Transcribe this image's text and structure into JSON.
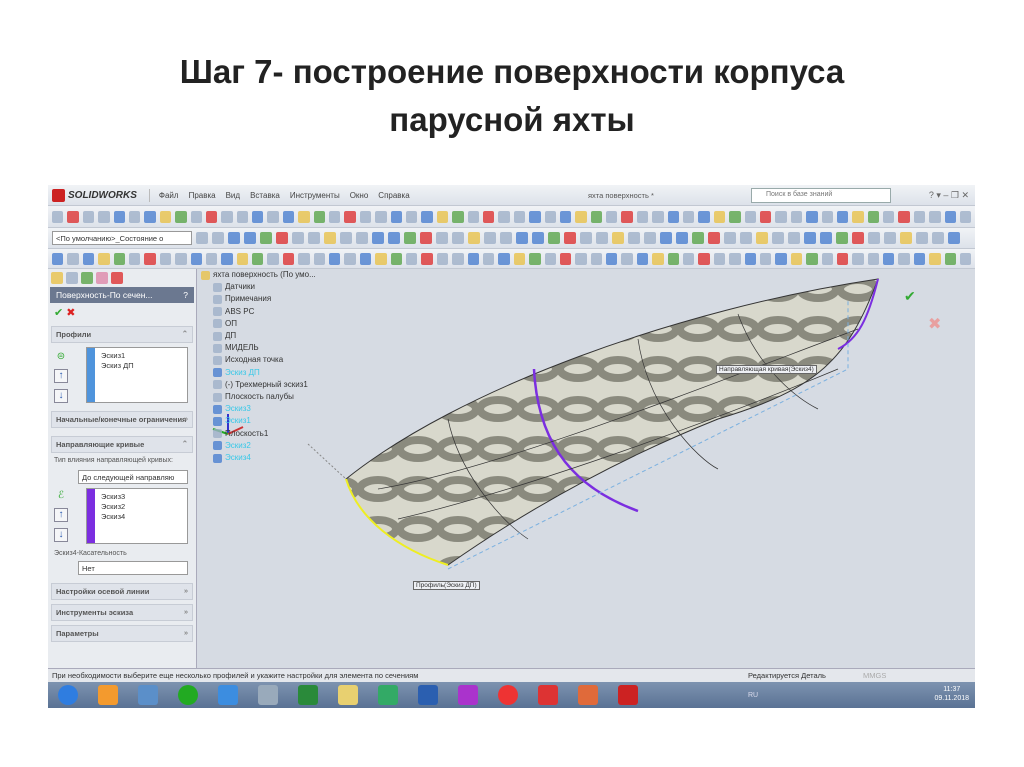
{
  "slide": {
    "title_line1": "Шаг 7- построение поверхности корпуса",
    "title_line2": "парусной яхты"
  },
  "app": {
    "brand": "SOLIDWORKS",
    "menu": [
      "Файл",
      "Правка",
      "Вид",
      "Вставка",
      "Инструменты",
      "Окно",
      "Справка"
    ],
    "doc_title": "яхта поверхность *",
    "search_placeholder": "Поиск в базе знаний",
    "config": "<По умолчанию>_Состояние о"
  },
  "panel": {
    "title": "Поверхность-По сечен...",
    "help": "?",
    "profiles_label": "Профили",
    "profiles": [
      "Эскиз1",
      "Эскиз ДП"
    ],
    "start_end": "Начальные/конечные ограничения",
    "guides_label": "Направляющие кривые",
    "guide_type_label": "Тип влияния направляющей кривых:",
    "guide_type": "До следующей направляю",
    "guides": [
      "Эскиз3",
      "Эскиз2",
      "Эскиз4"
    ],
    "tangency_label": "Эскиз4-Касательность",
    "tangency": "Нет",
    "axis": "Настройки осевой линии",
    "sketch_tools": "Инструменты эскиза",
    "params": "Параметры"
  },
  "tree": {
    "root": "яхта поверхность (По умо...",
    "items": [
      "Датчики",
      "Примечания",
      "ABS PC",
      "ОП",
      "ДП",
      "МИДЕЛЬ",
      "Исходная точка",
      "Эскиз ДП",
      "(-) Трехмерный эскиз1",
      "Плоскость палубы",
      "Эскиз3",
      "Эскиз1",
      "Плоскость1",
      "Эскиз2",
      "Эскиз4"
    ]
  },
  "viewport": {
    "guide_label": "Направляющая кривая(Эскиз4)",
    "profile_label": "Профиль(Эскиз ДП)"
  },
  "status": {
    "hint": "При необходимости выберите еще несколько профилей и укажите настройки для элемента по сечениям",
    "mode": "Редактируется Деталь",
    "units": "MMGS"
  },
  "taskbar": {
    "lang": "RU",
    "time": "11:37",
    "date": "09.11.2018"
  },
  "colors": {
    "accent": "#6b7890",
    "guide": "#7b2ee0"
  }
}
